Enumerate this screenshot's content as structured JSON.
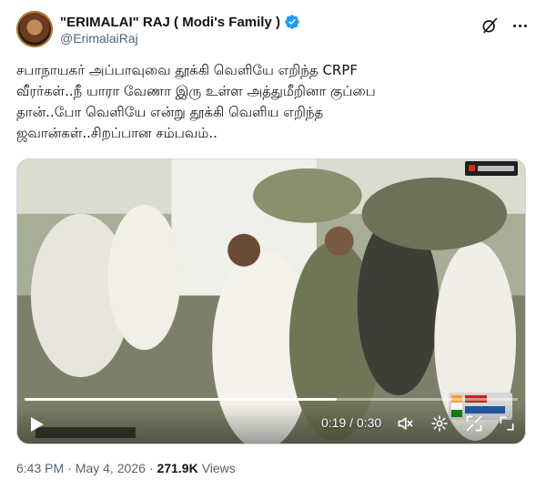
{
  "author": {
    "display_name": "\"ERIMALAI\" RAJ ( Modi's Family )",
    "handle": "@ErimalaiRaj",
    "verified_color": "#1d9bf0"
  },
  "tweet": {
    "lines": [
      "சபாநாயகர் அப்பாவுவை தூக்கி வெளியே எறிந்த CRPF",
      "வீரர்கள்..நீ யாரா வேணா இரு உள்ள அத்துமீறினா குப்பை",
      "தான்..போ வெளியே என்று தூக்கி வெளிய  எறிந்த",
      "ஜவான்கள்..சிறப்பான சம்பவம்.."
    ]
  },
  "video": {
    "time_display": "0:19 / 0:30",
    "progress_fraction": 0.633,
    "icons": [
      "play-icon",
      "volume-icon",
      "settings-icon",
      "fullscreen-icon",
      "expand-icon"
    ]
  },
  "meta": {
    "time": "6:43 PM",
    "separator": "·",
    "date": "May 4, 2026",
    "views_count": "271.9K",
    "views_label": "Views"
  },
  "colors": {
    "text_primary": "#0f1419",
    "text_secondary": "#536471",
    "accent": "#1d9bf0",
    "border": "#cfd9de"
  }
}
